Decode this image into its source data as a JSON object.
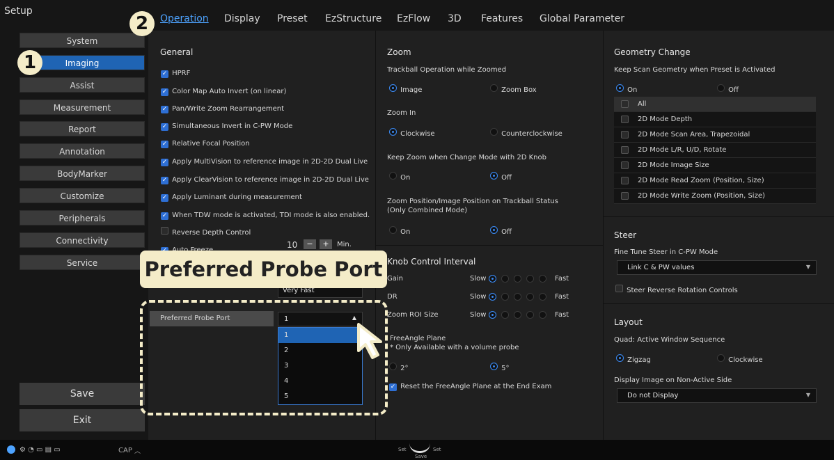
{
  "app": {
    "title": "Setup"
  },
  "tabs": [
    "Operation",
    "Display",
    "Preset",
    "EzStructure",
    "EzFlow",
    "3D",
    "Features",
    "Global Parameter"
  ],
  "sidebar": {
    "items": [
      "System",
      "Imaging",
      "Assist",
      "Measurement",
      "Report",
      "Annotation",
      "BodyMarker",
      "Customize",
      "Peripherals",
      "Connectivity",
      "Service"
    ],
    "save": "Save",
    "exit": "Exit"
  },
  "general": {
    "title": "General",
    "options": [
      {
        "label": "HPRF",
        "checked": true
      },
      {
        "label": "Color Map Auto Invert (on linear)",
        "checked": true
      },
      {
        "label": "Pan/Write Zoom Rearrangement",
        "checked": true
      },
      {
        "label": "Simultaneous Invert in C-PW Mode",
        "checked": true
      },
      {
        "label": "Relative Focal Position",
        "checked": true
      },
      {
        "label": "Apply MultiVision to reference image in 2D-2D Dual Live",
        "checked": true
      },
      {
        "label": "Apply ClearVision to reference image in 2D-2D Dual Live",
        "checked": true
      },
      {
        "label": "Apply Luminant during measurement",
        "checked": true
      },
      {
        "label": "When TDW mode is activated, TDI mode is also enabled.",
        "checked": true
      },
      {
        "label": "Reverse Depth Control",
        "checked": false
      }
    ],
    "auto_freeze": {
      "label": "Auto Freeze",
      "value": "10",
      "unit": "Min."
    },
    "speed_value": "Very Fast",
    "probe_port": {
      "label": "Preferred Probe Port",
      "value": "1",
      "options": [
        "1",
        "2",
        "3",
        "4",
        "5"
      ]
    }
  },
  "zoom": {
    "title": "Zoom",
    "trackball": {
      "label": "Trackball Operation while Zoomed",
      "opt1": "Image",
      "opt2": "Zoom Box"
    },
    "zoom_in": {
      "label": "Zoom In",
      "opt1": "Clockwise",
      "opt2": "Counterclockwise"
    },
    "keep_zoom": {
      "label": "Keep Zoom when Change Mode with 2D Knob",
      "opt1": "On",
      "opt2": "Off"
    },
    "zoom_pos": {
      "label1": "Zoom Position/Image Position on Trackball Status",
      "label2": "(Only Combined Mode)",
      "opt1": "On",
      "opt2": "Off"
    }
  },
  "knob": {
    "title": "Knob Control Interval",
    "rows": [
      {
        "label": "Gain",
        "slow": "Slow",
        "fast": "Fast"
      },
      {
        "label": "DR",
        "slow": "Slow",
        "fast": "Fast"
      },
      {
        "label": "Zoom ROI Size",
        "slow": "Slow",
        "fast": "Fast"
      }
    ],
    "freeangle": {
      "label1": "FreeAngle Plane",
      "label2": "* Only Available with a volume probe",
      "opt1": "2°",
      "opt2": "5°"
    },
    "reset": "Reset the FreeAngle Plane at the End Exam"
  },
  "geometry": {
    "title": "Geometry Change",
    "keep_label": "Keep Scan Geometry when Preset is Activated",
    "opt1": "On",
    "opt2": "Off",
    "items": [
      "All",
      "2D Mode Depth",
      "2D Mode Scan Area, Trapezoidal",
      "2D Mode L/R, U/D, Rotate",
      "2D Mode Image Size",
      "2D Mode Read Zoom (Position, Size)",
      "2D Mode Write Zoom (Position, Size)"
    ]
  },
  "steer": {
    "title": "Steer",
    "fine_label": "Fine Tune Steer in C-PW Mode",
    "fine_value": "Link C & PW values",
    "reverse": "Steer Reverse Rotation Controls"
  },
  "layout": {
    "title": "Layout",
    "quad_label": "Quad: Active Window Sequence",
    "opt1": "Zigzag",
    "opt2": "Clockwise",
    "display_label": "Display Image on Non-Active Side",
    "display_value": "Do not Display"
  },
  "status": {
    "cap": "CAP",
    "set_left": "Set",
    "set_right": "Set",
    "save": "Save"
  },
  "callouts": {
    "one": "1",
    "two": "2",
    "probe": "Preferred Probe Port"
  },
  "colors": {
    "accent": "#1f64b4",
    "callout": "#f4ecc8",
    "check": "#2e6fd4"
  }
}
